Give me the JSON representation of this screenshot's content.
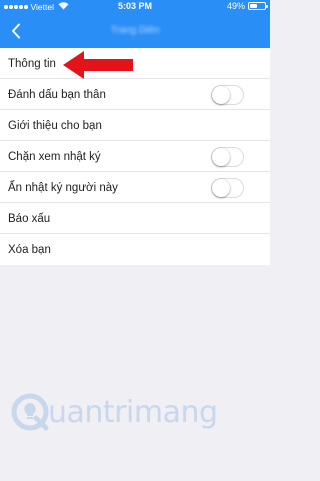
{
  "status_bar": {
    "carrier": "Viettel",
    "time": "5:03 PM",
    "battery_text": "49%",
    "battery_level": 0.49
  },
  "nav_bar": {
    "title": "Trang Diên"
  },
  "menu": {
    "items": [
      {
        "label": "Thông tin"
      },
      {
        "label": "Đánh dấu bạn thân",
        "toggle": false
      },
      {
        "label": "Giới thiệu cho bạn"
      },
      {
        "label": "Chặn xem nhật ký",
        "toggle": false
      },
      {
        "label": "Ẩn nhật ký người này",
        "toggle": false
      },
      {
        "label": "Báo xấu"
      },
      {
        "label": "Xóa bạn"
      }
    ]
  },
  "colors": {
    "header_blue": "#2a8ef7",
    "background": "#efeff4",
    "arrow_red": "#e3121b"
  },
  "watermark": {
    "text": "uantrimang"
  }
}
